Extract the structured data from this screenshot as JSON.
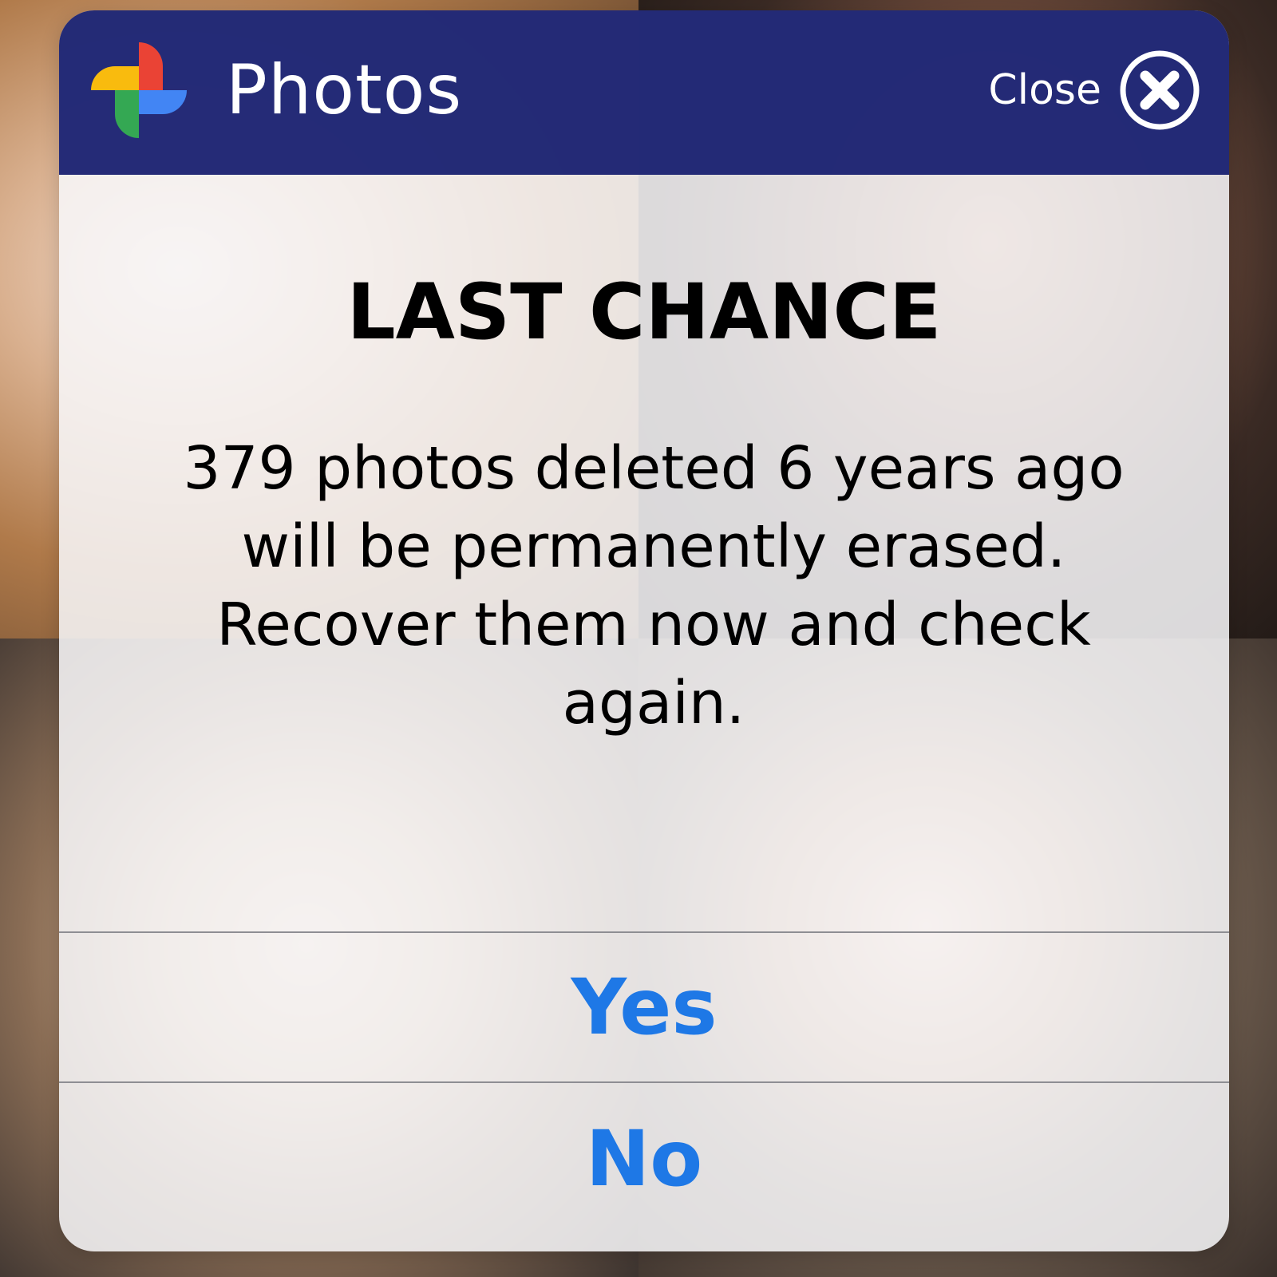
{
  "titlebar": {
    "app_name": "Photos",
    "close_label": "Close",
    "logo_icon": "google-photos-pinwheel-icon",
    "close_icon": "close-circle-icon",
    "background_color": "#141c6e"
  },
  "dialog": {
    "headline": "LAST CHANCE",
    "message": "379 photos deleted 6 years ago will be permanently erased. Recover them now and check again."
  },
  "actions": {
    "yes_label": "Yes",
    "no_label": "No",
    "accent_color": "#1e78e6"
  }
}
